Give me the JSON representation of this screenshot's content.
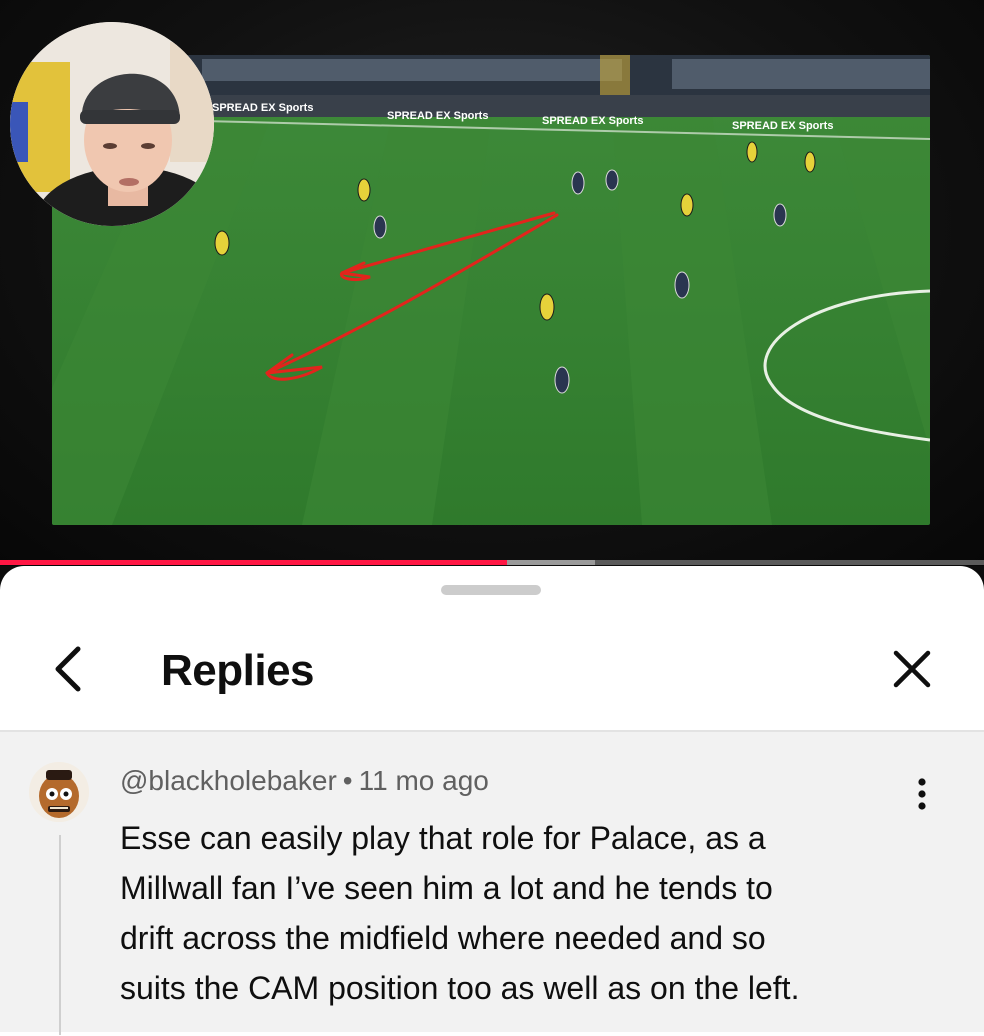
{
  "video": {
    "board_text": "SPREAD EX Sports",
    "progress_fraction": 0.515,
    "buffered_fraction": 0.605,
    "accent": "#ff1744"
  },
  "sheet": {
    "title": "Replies",
    "back_icon": "chevron-left-icon",
    "close_icon": "close-icon"
  },
  "comment": {
    "username": "@blackholebaker",
    "separator": "•",
    "time": "11 mo ago",
    "lines": [
      "Esse can easily play that role for Palace, as a",
      "Millwall fan I’ve seen him a lot and he tends to",
      "drift across the midfield where needed and so",
      "suits the CAM position too as well as on the left."
    ],
    "menu_icon": "more-vertical-icon"
  }
}
